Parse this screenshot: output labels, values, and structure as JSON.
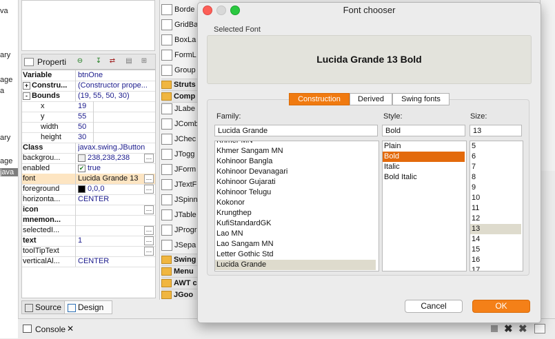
{
  "left_strip": [
    "va",
    "ary",
    "age",
    "a",
    "ary",
    "age",
    "java"
  ],
  "properties": {
    "tab_label": "Properti",
    "rows": [
      {
        "name": "Variable",
        "value": "btnOne",
        "bold": true,
        "ell": false
      },
      {
        "name": "Constru...",
        "value": "(Constructor prope...",
        "bold": true,
        "exp": "+",
        "ell": false
      },
      {
        "name": "Bounds",
        "value": "(19, 55, 50, 30)",
        "bold": true,
        "exp": "-",
        "ell": false
      },
      {
        "name": "x",
        "value": "19",
        "indent": true,
        "ell": false
      },
      {
        "name": "y",
        "value": "55",
        "indent": true,
        "ell": false
      },
      {
        "name": "width",
        "value": "50",
        "indent": true,
        "ell": false
      },
      {
        "name": "height",
        "value": "30",
        "indent": true,
        "ell": false
      },
      {
        "name": "Class",
        "value": "javax.swing.JButton",
        "bold": true,
        "ell": false
      },
      {
        "name": "backgrou...",
        "value": "238,238,238",
        "swatch": "#eeeeee",
        "ell": true
      },
      {
        "name": "enabled",
        "value": "true",
        "check": true,
        "ell": false
      },
      {
        "name": "font",
        "value": "Lucida Grande 13",
        "black": true,
        "selected": true,
        "ell": true
      },
      {
        "name": "foreground",
        "value": "0,0,0",
        "swatch": "#000000",
        "ell": true
      },
      {
        "name": "horizonta...",
        "value": "CENTER",
        "ell": false
      },
      {
        "name": "icon",
        "value": "",
        "bold": true,
        "ell": true
      },
      {
        "name": "mnemon...",
        "value": "",
        "bold": true,
        "ell": false
      },
      {
        "name": "selectedI...",
        "value": "",
        "ell": true
      },
      {
        "name": "text",
        "value": "1",
        "bold": true,
        "ell": true
      },
      {
        "name": "toolTipText",
        "value": "",
        "ell": true
      },
      {
        "name": "verticalAl...",
        "value": "CENTER",
        "ell": false
      }
    ]
  },
  "bottom_tabs": {
    "source": "Source",
    "design": "Design"
  },
  "console_label": "Console",
  "palette": [
    {
      "label": "Borde",
      "folder": false,
      "icon": "border-layout-icon"
    },
    {
      "label": "GridBa",
      "folder": false,
      "icon": "gridbag-layout-icon"
    },
    {
      "label": "BoxLa",
      "folder": false,
      "icon": "box-layout-icon"
    },
    {
      "label": "FormL",
      "folder": false,
      "icon": "form-layout-icon"
    },
    {
      "label": "Group",
      "folder": false,
      "icon": "group-layout-icon"
    },
    {
      "label": "Struts",
      "folder": true
    },
    {
      "label": "Comp",
      "folder": true
    },
    {
      "label": "JLabe",
      "folder": false,
      "icon": "jlabel-icon"
    },
    {
      "label": "JComb",
      "folder": false,
      "icon": "jcombobox-icon"
    },
    {
      "label": "JChec",
      "folder": false,
      "icon": "jcheckbox-icon"
    },
    {
      "label": "JTogg",
      "folder": false,
      "icon": "jtogglebutton-icon"
    },
    {
      "label": "JForm",
      "folder": false,
      "icon": "jformattedtextfield-icon"
    },
    {
      "label": "JTextF",
      "folder": false,
      "icon": "jtextfield-icon"
    },
    {
      "label": "JSpinn",
      "folder": false,
      "icon": "jspinner-icon"
    },
    {
      "label": "JTable",
      "folder": false,
      "icon": "jtable-icon"
    },
    {
      "label": "JProgr",
      "folder": false,
      "icon": "jprogressbar-icon"
    },
    {
      "label": "JSepa",
      "folder": false,
      "icon": "jseparator-icon"
    },
    {
      "label": "Swing",
      "folder": true
    },
    {
      "label": "Menu",
      "folder": true
    },
    {
      "label": "AWT c",
      "folder": true
    },
    {
      "label": "JGoo",
      "folder": true
    }
  ],
  "dialog": {
    "title": "Font chooser",
    "selected_font_label": "Selected Font",
    "preview_text": "Lucida Grande 13 Bold",
    "tabs": [
      "Construction",
      "Derived",
      "Swing fonts"
    ],
    "active_tab": "Construction",
    "family_label": "Family:",
    "style_label": "Style:",
    "size_label": "Size:",
    "family_value": "Lucida Grande",
    "style_value": "Bold",
    "size_value": "13",
    "families": [
      "Khmer MN",
      "Khmer Sangam MN",
      "Kohinoor Bangla",
      "Kohinoor Devanagari",
      "Kohinoor Gujarati",
      "Kohinoor Telugu",
      "Kokonor",
      "Krungthep",
      "KufiStandardGK",
      "Lao MN",
      "Lao Sangam MN",
      "Letter Gothic Std",
      "Lucida Grande"
    ],
    "styles": [
      "Plain",
      "Bold",
      "Italic",
      "Bold Italic"
    ],
    "sizes": [
      "5",
      "6",
      "7",
      "8",
      "9",
      "10",
      "11",
      "12",
      "13",
      "14",
      "15",
      "16",
      "17"
    ],
    "cancel": "Cancel",
    "ok": "OK"
  },
  "colors": {
    "accent": "#f07a10",
    "selection": "#e36a0c",
    "close": "#fc5f57",
    "minimize": "#d8d8d8",
    "zoom": "#2ac840"
  }
}
